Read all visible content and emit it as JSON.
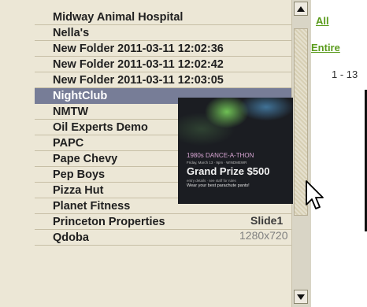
{
  "list": {
    "items": [
      {
        "label": "Midway Animal Hospital",
        "selected": false
      },
      {
        "label": "Nella's",
        "selected": false
      },
      {
        "label": "New Folder 2011-03-11 12:02:36",
        "selected": false
      },
      {
        "label": "New Folder 2011-03-11 12:02:42",
        "selected": false
      },
      {
        "label": "New Folder 2011-03-11 12:03:05",
        "selected": false
      },
      {
        "label": "NightClub",
        "selected": true
      },
      {
        "label": "NMTW",
        "selected": false
      },
      {
        "label": "Oil Experts Demo",
        "selected": false
      },
      {
        "label": "PAPC",
        "selected": false
      },
      {
        "label": "Pape Chevy",
        "selected": false
      },
      {
        "label": "Pep Boys",
        "selected": false
      },
      {
        "label": "Pizza Hut",
        "selected": false
      },
      {
        "label": "Planet Fitness",
        "selected": false
      },
      {
        "label": "Princeton Properties",
        "selected": false
      },
      {
        "label": "Qdoba",
        "selected": false
      }
    ]
  },
  "right_panel": {
    "link_all": "All",
    "link_entire": "Entire",
    "range_text": "1 - 13"
  },
  "preview": {
    "line_1980": "1980s DANCE-A-THON",
    "line_subtitle": "Friday, March 13 · 9pm · WINDMEWR",
    "line_prize": "Grand Prize $500",
    "line_fine": "entry details · see staff for rules",
    "line_wear": "Wear your best parachute pants!",
    "slide_name": "Slide1",
    "slide_dims": "1280x720"
  },
  "colors": {
    "panel_bg": "#ece7d6",
    "selected_bg": "#777d97",
    "link_green": "#5a9b1c"
  },
  "icons": {
    "scroll_up": "triangle-up-icon",
    "scroll_down": "triangle-down-icon",
    "cursor": "arrow-cursor-icon"
  }
}
